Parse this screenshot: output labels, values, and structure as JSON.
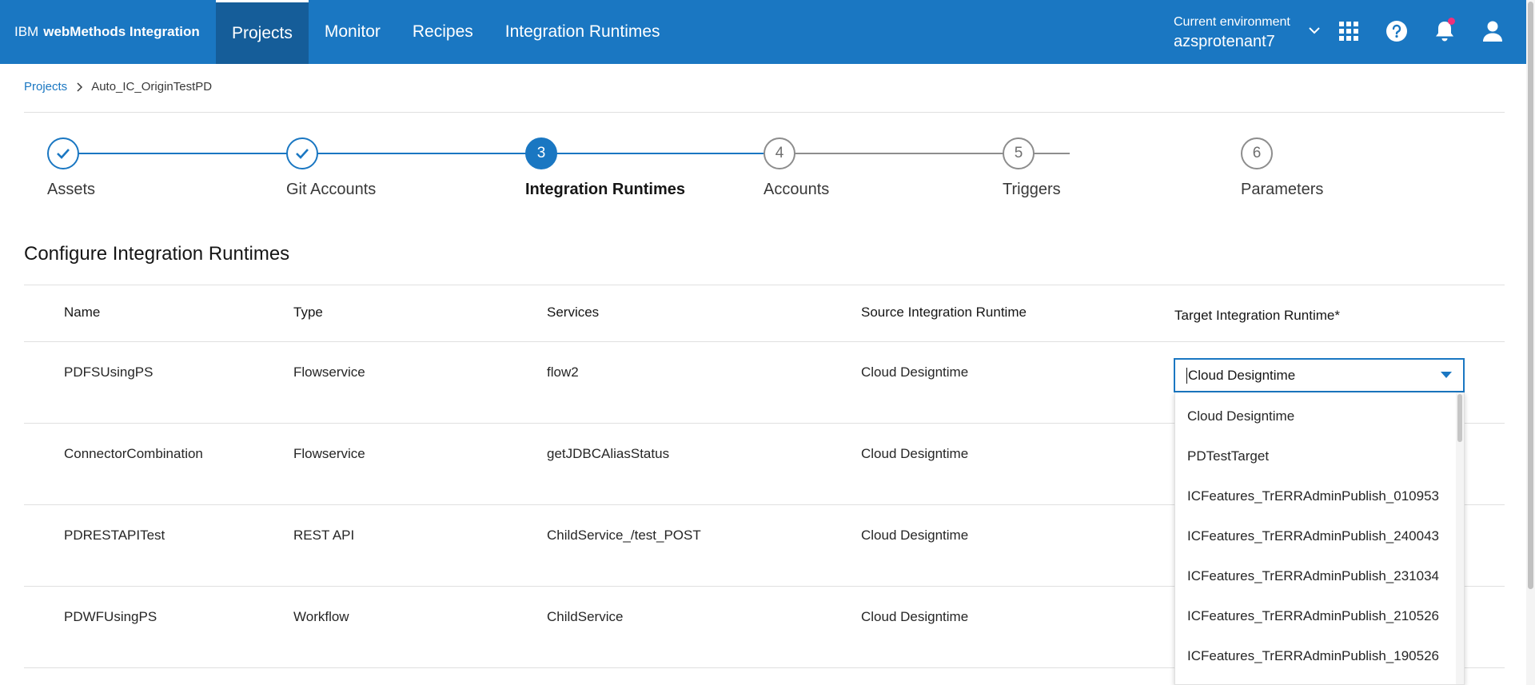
{
  "header": {
    "brand_ibm": "IBM",
    "brand_product": "webMethods Integration",
    "nav": [
      {
        "label": "Projects",
        "active": true
      },
      {
        "label": "Monitor"
      },
      {
        "label": "Recipes"
      },
      {
        "label": "Integration Runtimes"
      }
    ],
    "env_label": "Current environment",
    "env_value": "azsprotenant7",
    "icons": [
      "app-switcher-icon",
      "help-icon",
      "notification-icon",
      "user-icon"
    ]
  },
  "breadcrumb": {
    "root": "Projects",
    "current": "Auto_IC_OriginTestPD"
  },
  "stepper": {
    "steps": [
      {
        "number": "1",
        "label": "Assets",
        "state": "done"
      },
      {
        "number": "2",
        "label": "Git Accounts",
        "state": "done"
      },
      {
        "number": "3",
        "label": "Integration Runtimes",
        "state": "current"
      },
      {
        "number": "4",
        "label": "Accounts",
        "state": "todo"
      },
      {
        "number": "5",
        "label": "Triggers",
        "state": "todo"
      },
      {
        "number": "6",
        "label": "Parameters",
        "state": "todo"
      }
    ]
  },
  "section_title": "Configure Integration Runtimes",
  "table": {
    "columns": [
      "Name",
      "Type",
      "Services",
      "Source Integration Runtime",
      "Target Integration Runtime*"
    ],
    "rows": [
      {
        "name": "PDFSUsingPS",
        "type": "Flowservice",
        "services": "flow2",
        "source": "Cloud Designtime"
      },
      {
        "name": "ConnectorCombination",
        "type": "Flowservice",
        "services": "getJDBCAliasStatus",
        "source": "Cloud Designtime"
      },
      {
        "name": "PDRESTAPITest",
        "type": "REST API",
        "services": "ChildService_/test_POST",
        "source": "Cloud Designtime"
      },
      {
        "name": "PDWFUsingPS",
        "type": "Workflow",
        "services": "ChildService",
        "source": "Cloud Designtime"
      }
    ]
  },
  "target_select": {
    "value": "Cloud Designtime",
    "options": [
      "Cloud Designtime",
      "PDTestTarget",
      "ICFeatures_TrERRAdminPublish_010953",
      "ICFeatures_TrERRAdminPublish_240043",
      "ICFeatures_TrERRAdminPublish_231034",
      "ICFeatures_TrERRAdminPublish_210526",
      "ICFeatures_TrERRAdminPublish_190526"
    ]
  },
  "colors": {
    "brand": "#1a77c2",
    "nav_active": "#155d99",
    "notification_dot": "#f0307a"
  }
}
